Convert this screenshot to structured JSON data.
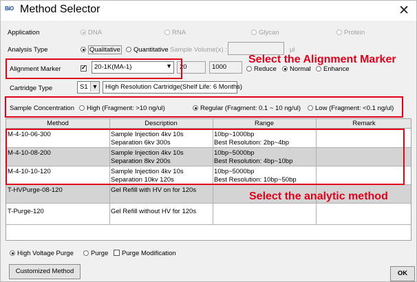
{
  "window": {
    "logo_bio": "BiO",
    "title": "Method Selector",
    "close": "✕"
  },
  "application": {
    "label": "Application",
    "options": [
      "DNA",
      "RNA",
      "Glycan",
      "Protein"
    ],
    "selected": "DNA"
  },
  "analysis_type": {
    "label": "Analysis Type",
    "options": [
      "Qualitative",
      "Quantitative"
    ],
    "selected": "Qualitative",
    "sample_volume_label": "Sample Volume(x) :",
    "sample_volume_value": "",
    "unit": "μl"
  },
  "alignment_marker": {
    "label": "Alignment Marker",
    "checked": true,
    "value": "20-1K(MA-1)",
    "low": "20",
    "high": "1000",
    "modes": [
      "Reduce",
      "Normal",
      "Enhance"
    ],
    "selected_mode": "Normal"
  },
  "cartridge": {
    "label": "Cartridge Type",
    "value": "S1",
    "description": "High Resolution Cartridge(Shelf Life: 6 Months)"
  },
  "sample_concentration": {
    "label": "Sample Concentration",
    "options": [
      "High (Fragment: >10 ng/ul)",
      "Regular (Fragment: 0.1 ~ 10 ng/ul)",
      "Low (Fragment: <0.1 ng/ul)"
    ],
    "selected": 1
  },
  "table": {
    "columns": [
      "Method",
      "Description",
      "Range",
      "Remark"
    ],
    "rows": [
      {
        "method": "M-4-10-06-300",
        "desc1": "Sample Injection 4kv 10s",
        "desc2": "Separation 6kv 300s",
        "range1": "10bp~1000bp",
        "range2": "Best Resolution: 2bp~4bp",
        "remark": ""
      },
      {
        "method": "M-4-10-08-200",
        "desc1": "Sample Injection 4kv 10s",
        "desc2": "Separation 8kv 200s",
        "range1": "10bp~5000bp",
        "range2": "Best Resolution: 4bp~10bp",
        "remark": ""
      },
      {
        "method": "M-4-10-10-120",
        "desc1": "Sample Injection 4kv 10s",
        "desc2": "Separation 10kv 120s",
        "range1": "10bp~5000bp",
        "range2": "Best Resolution: 10bp~50bp",
        "remark": ""
      },
      {
        "method": "T-HVPurge-08-120",
        "desc1": "Gel Refill with HV on for 120s",
        "desc2": "",
        "range1": "",
        "range2": "",
        "remark": ""
      },
      {
        "method": "T-Purge-120",
        "desc1": "Gel Refill without HV for 120s",
        "desc2": "",
        "range1": "",
        "range2": "",
        "remark": ""
      }
    ]
  },
  "purge": {
    "options": [
      "High Voltage Purge",
      "Purge"
    ],
    "selected": "High Voltage Purge",
    "modification_label": "Purge Modification",
    "modification_checked": false
  },
  "buttons": {
    "customized": "Customized Method",
    "ok": "OK"
  },
  "annotations": {
    "alignment": "Select the Alignment Marker",
    "method": "Select the analytic method"
  },
  "colors": {
    "highlight": "#e3001b",
    "gray_row": "#d4d4d4"
  }
}
